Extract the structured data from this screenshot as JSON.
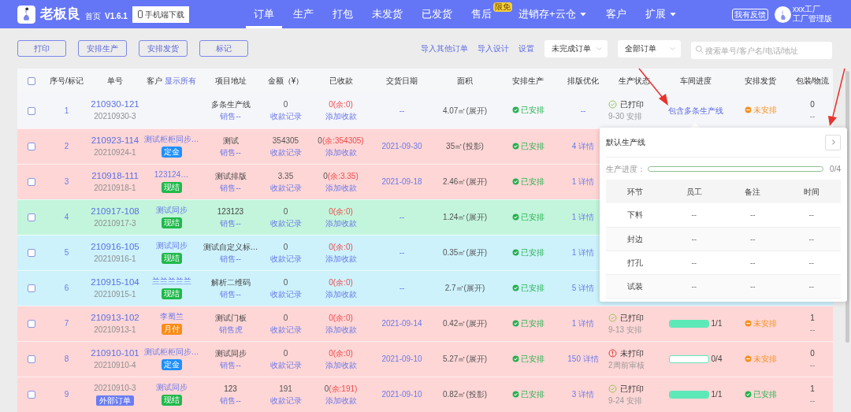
{
  "header": {
    "brand": "老板良",
    "home": "首页",
    "version": "V1.6.1",
    "download_button": "手机端下载",
    "nav": [
      {
        "label": "订单",
        "selected": true,
        "dropdown": false
      },
      {
        "label": "生产",
        "selected": false,
        "dropdown": false
      },
      {
        "label": "打包",
        "selected": false,
        "dropdown": false
      },
      {
        "label": "未发货",
        "selected": false,
        "dropdown": false
      },
      {
        "label": "已发货",
        "selected": false,
        "dropdown": false
      },
      {
        "label": "售后",
        "selected": false,
        "dropdown": false,
        "badge": "限免"
      },
      {
        "label": "进销存+云仓",
        "selected": false,
        "dropdown": true
      },
      {
        "label": "客户",
        "selected": false,
        "dropdown": false
      },
      {
        "label": "扩展",
        "selected": false,
        "dropdown": true
      }
    ],
    "feedback": "我有反馈",
    "user": {
      "name": "xxx工厂",
      "role": "工厂管理版"
    }
  },
  "toolbar": {
    "buttons": [
      "打印",
      "安排生产",
      "安排发货",
      "标记"
    ],
    "links": [
      "导入其他订单",
      "导入设计",
      "设置"
    ],
    "filters": [
      {
        "value": "未完成订单"
      },
      {
        "value": "全部订单"
      }
    ],
    "search": {
      "placeholder": "搜索单号/客户名/电话/地址"
    }
  },
  "table": {
    "header_checked": false,
    "columns": [
      {
        "label": "序号/标记"
      },
      {
        "label": "单号"
      },
      {
        "label": "客户",
        "link": "显示所有"
      },
      {
        "label": "项目地址"
      },
      {
        "label": "金额（¥）"
      },
      {
        "label": "已收款"
      },
      {
        "label": "交货日期"
      },
      {
        "label": "面积"
      },
      {
        "label": "安排生产"
      },
      {
        "label": "排版优化"
      },
      {
        "label": "生产状态"
      },
      {
        "label": "车间进度"
      },
      {
        "label": "安排发货"
      },
      {
        "label": "包装/物流"
      }
    ],
    "rows": [
      {
        "color": "#f5f6fa",
        "checked": false,
        "index": "1",
        "order_no": "210930-121",
        "sub_no": "20210930-3",
        "address": "多条生产线",
        "sales": "销售--",
        "amount": "0",
        "payment_records": "收款记录",
        "received": "0",
        "balance": "(余:0)",
        "received_alert": true,
        "add_payment": "添加收款",
        "delivery": "--",
        "area": "4.07㎡(展开)",
        "production": {
          "kind": "arranged",
          "text": "已安排"
        },
        "layout": "--",
        "status": {
          "kind": "printed",
          "text": "已打印",
          "note": "9-30 安排"
        },
        "workshop": {
          "kind": "link",
          "text": "包含多条生产线"
        },
        "shipping": {
          "kind": "unarranged",
          "text": "未安排"
        },
        "packing": "0",
        "logistics": "--"
      },
      {
        "color": "#ffd6d6",
        "checked": false,
        "index": "2",
        "order_no": "210923-114",
        "sub_no": "20210924-1",
        "customer": {
          "name": "测试柜柜同步…",
          "badge": {
            "text": "定金",
            "color": "#1e90ff"
          }
        },
        "address": "测试",
        "sales": "销售--",
        "amount": "354305",
        "payment_records": "收款记录",
        "received": "0",
        "balance": "(余:354305)",
        "received_alert": false,
        "add_payment": "添加收款",
        "delivery": "2021-09-30",
        "area": "35㎡(投影)",
        "production": {
          "kind": "arranged",
          "text": "已安排"
        },
        "layout": "4 详情"
      },
      {
        "color": "#ffd6d6",
        "checked": false,
        "index": "3",
        "order_no": "210918-111",
        "sub_no": "20210918-1",
        "customer": {
          "name": "123124…",
          "badge": {
            "text": "现结",
            "color": "#1fb94a"
          }
        },
        "address": "测试排版",
        "sales": "销售--",
        "amount": "3.35",
        "payment_records": "收款记录",
        "received": "0",
        "balance": "(余:3.35)",
        "received_alert": false,
        "add_payment": "添加收款",
        "delivery": "2021-09-18",
        "area": "2.46㎡(展开)",
        "production": {
          "kind": "arranged",
          "text": "已安排"
        },
        "layout": "1 详情"
      },
      {
        "color": "#c3f5dc",
        "checked": false,
        "index": "4",
        "order_no": "210917-108",
        "sub_no": "20210917-3",
        "customer": {
          "name": "测试同步",
          "badge": {
            "text": "现结",
            "color": "#1fb94a"
          }
        },
        "address": "123123",
        "sales": "销售--",
        "amount": "0",
        "payment_records": "收款记录",
        "received": "0",
        "balance": "(余:0)",
        "received_alert": true,
        "add_payment": "添加收款",
        "delivery": "--",
        "area": "1.24㎡(展开)",
        "production": {
          "kind": "arranged",
          "text": "已安排"
        },
        "layout": "1 详情"
      },
      {
        "color": "#cdf2fc",
        "checked": false,
        "index": "5",
        "order_no": "210916-105",
        "sub_no": "20210916-1",
        "customer": {
          "name": "测试同步",
          "badge": {
            "text": "现结",
            "color": "#1fb94a"
          }
        },
        "address": "测试自定义标…",
        "sales": "销售--",
        "amount": "0",
        "payment_records": "收款记录",
        "received": "0",
        "balance": "(余:0)",
        "received_alert": true,
        "add_payment": "添加收款",
        "delivery": "--",
        "area": "0.35㎡(展开)",
        "production": {
          "kind": "arranged",
          "text": "已安排"
        },
        "layout": "1 详情"
      },
      {
        "color": "#cdf2fc",
        "checked": false,
        "index": "6",
        "order_no": "210915-104",
        "sub_no": "20210915-1",
        "customer": {
          "name": "兰兰兰兰兰",
          "badge": {
            "text": "现结",
            "color": "#1fb94a"
          }
        },
        "address": "解析二维码",
        "sales": "销售--",
        "amount": "0",
        "payment_records": "收款记录",
        "received": "0",
        "balance": "(余:0)",
        "received_alert": true,
        "add_payment": "添加收款",
        "delivery": "--",
        "area": "2.7㎡(展开)",
        "production": {
          "kind": "arranged",
          "text": "已安排"
        },
        "layout": "5 详情"
      },
      {
        "color": "#ffd6d6",
        "checked": false,
        "index": "7",
        "order_no": "210913-102",
        "sub_no": "20210913-1",
        "customer": {
          "name": "李蜀兰",
          "badge": {
            "text": "月付",
            "color": "#fa8c16"
          }
        },
        "address": "测试门板",
        "sales": "销售虎",
        "amount": "0",
        "payment_records": "收款记录",
        "received": "0",
        "balance": "(余:0)",
        "received_alert": true,
        "add_payment": "添加收款",
        "delivery": "2021-09-14",
        "area": "0.42㎡(展开)",
        "production": {
          "kind": "arranged",
          "text": "已安排"
        },
        "layout": "1 详情",
        "status": {
          "kind": "printed",
          "text": "已打印",
          "note": "9-13 安排"
        },
        "workshop": {
          "kind": "progress",
          "level": 1,
          "reading": "1/1"
        },
        "shipping": {
          "kind": "unarranged",
          "text": "未安排"
        },
        "packing": "1",
        "logistics": "--"
      },
      {
        "color": "#ffd6d6",
        "checked": false,
        "index": "8",
        "order_no": "210910-101",
        "sub_no": "20210910-4",
        "customer": {
          "name": "测试柜柜同步…",
          "badge": {
            "text": "定金",
            "color": "#1e90ff"
          }
        },
        "address": "测试同步",
        "sales": "销售--",
        "amount": "0",
        "payment_records": "收款记录",
        "received": "0",
        "balance": "(余:0)",
        "received_alert": true,
        "add_payment": "添加收款",
        "delivery": "2021-09-10",
        "area": "5.27㎡(展开)",
        "production": {
          "kind": "arranged",
          "text": "已安排"
        },
        "layout": "150 详情",
        "status": {
          "kind": "unprinted",
          "text": "未打印",
          "note": "2周前审核"
        },
        "workshop": {
          "kind": "progress",
          "level": 0,
          "reading": "0/4"
        },
        "shipping": {
          "kind": "unarranged",
          "text": "未安排"
        },
        "packing": "0",
        "logistics": "--"
      },
      {
        "color": "#ffd6d6",
        "checked": false,
        "index": "9",
        "sub_no": "20210910-3",
        "order_badge": "外部订单",
        "customer": {
          "name": "测试同步",
          "badge": {
            "text": "现结",
            "color": "#1fb94a"
          }
        },
        "address": "123",
        "sales": "销售--",
        "amount": "191",
        "payment_records": "收款记录",
        "received": "0",
        "balance": "(余:191)",
        "received_alert": false,
        "add_payment": "添加收款",
        "delivery": "2021-09-10",
        "area": "0.82㎡(投影)",
        "production": {
          "kind": "arranged",
          "text": "已安排"
        },
        "layout": "3 详情",
        "status": {
          "kind": "printed",
          "text": "已打印",
          "note": "9-24 安排"
        },
        "workshop": {
          "kind": "progress",
          "level": 1,
          "reading": "1/1"
        },
        "shipping": {
          "kind": "arranged",
          "text": "已安排"
        },
        "packing": "1",
        "logistics": "--"
      }
    ]
  },
  "popover": {
    "title": "默认生产线",
    "progress_label": "生产进度：",
    "level": 0,
    "reading": "0/4",
    "columns": [
      "环节",
      "员工",
      "备注",
      "时间"
    ],
    "rows": [
      [
        "下料",
        "--",
        "--",
        "--"
      ],
      [
        "封边",
        "--",
        "--",
        "--"
      ],
      [
        "打孔",
        "--",
        "--",
        "--"
      ],
      [
        "试装",
        "--",
        "--",
        "--"
      ]
    ]
  }
}
